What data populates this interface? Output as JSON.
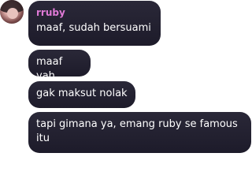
{
  "sender": {
    "name": "rruby",
    "avatar_icon": "user-avatar",
    "name_color": "#e07ad6"
  },
  "messages": [
    {
      "text": "maaf, sudah bersuami"
    },
    {
      "text": "maaf yah"
    },
    {
      "text": "gak maksut nolak"
    },
    {
      "text": "tapi gimana ya, emang ruby se famous itu"
    }
  ],
  "colors": {
    "bubble_bg": "#1d1b2a",
    "text": "#ffffff",
    "page_bg": "#ffffff"
  }
}
